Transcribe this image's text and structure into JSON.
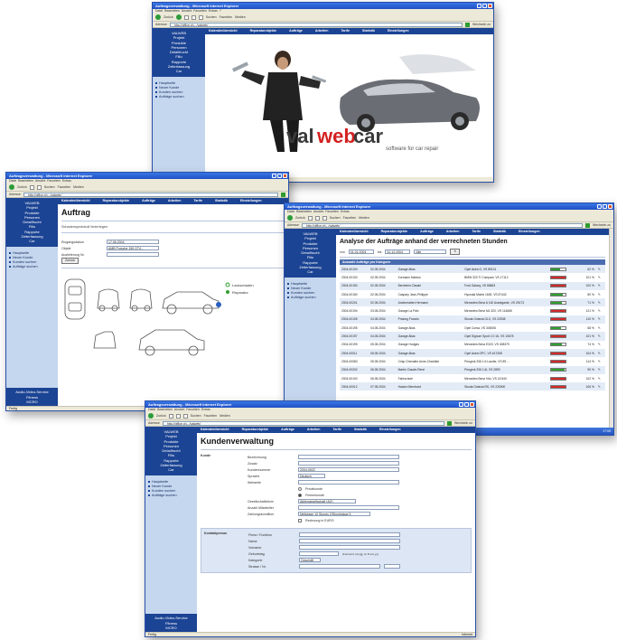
{
  "browser": {
    "title": "Auftragsverwaltung - Microsoft Internet Explorer",
    "menu": [
      "Datei",
      "Bearbeiten",
      "Ansicht",
      "Favoriten",
      "Extras",
      "?"
    ],
    "toolbar": {
      "back": "Zurück",
      "search": "Suchen",
      "favorites": "Favoriten",
      "media": "Medien"
    },
    "address_label": "Adresse",
    "address": "http://office.xh.../valweb/",
    "go_label": "Wechseln zu",
    "status_left": "Fertig",
    "status_right": "Internet"
  },
  "app": {
    "sidebar_nav": [
      "VALWEB",
      "Projekt",
      "Produkte",
      "Personen",
      "Detailfrucht",
      "Filiu",
      "Rapporte",
      "Zeiterfassung",
      "Car"
    ],
    "sidebar_links": [
      "Hauptseite",
      "Neuer Kunde",
      "Kunden suchen",
      "Aufträge suchen"
    ],
    "sidebar_footer": [
      "Audio-Video-Service",
      "Fitness",
      "MCRO"
    ],
    "top_nav": [
      "Kalenderübersicht",
      "Reparaturobjekte",
      "Aufträge",
      "Arbeiten",
      "Tarife",
      "Statistik",
      "Einstellungen"
    ]
  },
  "window1": {
    "logo_val": "val",
    "logo_web": "web",
    "logo_car": "car",
    "logo_tagline": "software for car repair"
  },
  "window2": {
    "page_title": "Auftrag",
    "subtitle": "Schadensprotokoll hinterlegen",
    "fields": [
      {
        "label": "Eingangsdatum",
        "value": "17.06.2004"
      },
      {
        "label": "Objekt",
        "value": "AMB Porsche 150 GT4..."
      },
      {
        "label": "Auslieferung Nr.",
        "value": ""
      }
    ],
    "button": "Zurück",
    "legend": [
      "Lackschaden",
      "Reparatur"
    ]
  },
  "window3": {
    "page_title": "Analyse der Aufträge anhand der verrechneten Stunden",
    "from_label": "von",
    "from": "01.01.2004",
    "to_label": "bis",
    "to": "31.12.2004",
    "filter": "Alle",
    "table_header": "Auswahl Aufträge pro Kategorie",
    "rows": [
      {
        "nr": "2004-00100",
        "date": "02.05.2004",
        "customer": "Garage Alias",
        "vehicle": "Opel Astra G, VS 89131",
        "fill": 0.62,
        "pct": "62 %",
        "color": "#2fa030"
      },
      {
        "nr": "2004-00100",
        "date": "02.05.2004",
        "customer": "Kurmann Markus",
        "vehicle": "BMW 323 TI Compact, VS 17112",
        "fill": 1.0,
        "pct": "101 %",
        "color": "#d22a2a"
      },
      {
        "nr": "2004-00150",
        "date": "02.05.2004",
        "customer": "Bernheim Claude",
        "vehicle": "Ford Galaxy, VS 86863",
        "fill": 1.0,
        "pct": "100 %",
        "color": "#d22a2a"
      },
      {
        "nr": "2004-00150",
        "date": "02.05.2004",
        "customer": "Caspary Jean-Philippe",
        "vehicle": "Hyundai Matrix 1600, VS 87442",
        "fill": 0.8,
        "pct": "80 %",
        "color": "#2fa030"
      },
      {
        "nr": "2004-00201",
        "date": "02.05.2004",
        "customer": "Andermatten Hermann",
        "vehicle": "Mercedes Benz A 140 Avantgarde, VS 25173",
        "fill": 0.71,
        "pct": "71 %",
        "color": "#2fa030"
      },
      {
        "nr": "2004-00194",
        "date": "03.05.2004",
        "customer": "Garage La Paix",
        "vehicle": "Mercedes Benz ML 320, VS 114665",
        "fill": 1.0,
        "pct": "121 %",
        "color": "#d22a2a"
      },
      {
        "nr": "2004-00105",
        "date": "04.05.2004",
        "customer": "Pralong Francis",
        "vehicle": "Skoda Octavia GLX, VS 22538",
        "fill": 1.0,
        "pct": "110 %",
        "color": "#d22a2a"
      },
      {
        "nr": "2004-00195",
        "date": "04.05.2004",
        "customer": "Garage Alias",
        "vehicle": "Opel Corsa, VS 345006",
        "fill": 0.68,
        "pct": "68 %",
        "color": "#2fa030"
      },
      {
        "nr": "2004-00197",
        "date": "04.05.2004",
        "customer": "Garage Alias",
        "vehicle": "Opel Signum Sport 2.0 16, VS 10678",
        "fill": 1.0,
        "pct": "101 %",
        "color": "#d22a2a"
      },
      {
        "nr": "2004-00199",
        "date": "05.05.2004",
        "customer": "Garage Hodges",
        "vehicle": "Mercedes Benz E320, VS 408379",
        "fill": 0.74,
        "pct": "74 %",
        "color": "#2fa030"
      },
      {
        "nr": "2004-00011",
        "date": "05.05.2004",
        "customer": "Garage Alias",
        "vehicle": "Opel Astra OPC, VS 617308",
        "fill": 1.0,
        "pct": "104 %",
        "color": "#d22a2a"
      },
      {
        "nr": "2004-00083",
        "date": "05.05.2004",
        "customer": "Crisp Chevalier Anne-Charlotte",
        "vehicle": "Peugeot 206 1.6 Laurier, VS 89 ...",
        "fill": 1.0,
        "pct": "114 %",
        "color": "#d22a2a"
      },
      {
        "nr": "2004-00202",
        "date": "06.05.2004",
        "customer": "Martin Claude-René",
        "vehicle": "Peugeot 206 1.6i, VS 2890",
        "fill": 0.9,
        "pct": "90 %",
        "color": "#2fa030"
      },
      {
        "nr": "2004-00100",
        "date": "06.05.2004",
        "customer": "Fahrschule",
        "vehicle": "Mercedes Benz Vito, VS 18 540",
        "fill": 1.0,
        "pct": "102 %",
        "color": "#d22a2a"
      },
      {
        "nr": "2004-00012",
        "date": "07.05.2004",
        "customer": "Hadorn Bernhard",
        "vehicle": "Skoda Octavia RS, VS 220900",
        "fill": 1.0,
        "pct": "106 %",
        "color": "#d22a2a"
      }
    ],
    "taskbar": {
      "start": "Start",
      "items": [
        "Microsoft...",
        "Auftragsv..."
      ],
      "clock": "17:05"
    }
  },
  "window4": {
    "page_title": "Kundenverwaltung",
    "section_kunde": "Kunde",
    "fields": [
      {
        "label": "Bezeichnung",
        "value": ""
      },
      {
        "label": "Zusatz",
        "value": ""
      },
      {
        "label": "Kundennummer",
        "value": "2004-0922"
      },
      {
        "label": "Sprache",
        "value": "Deutsch"
      },
      {
        "label": "Webseite",
        "value": ""
      }
    ],
    "radios": [
      "Privatkunde",
      "Firmenkunde"
    ],
    "fields2": [
      {
        "label": "Gesellschaftsform",
        "value": "Aktiengesellschaft (AG)"
      },
      {
        "label": "Anzahl Mitarbeiter",
        "value": ""
      },
      {
        "label": "Zahlungskondition",
        "value": "Nettotage 10 Skonto 2/Skontotage 5"
      }
    ],
    "checkbox": "Rechnung in EURO",
    "section_contact": "Kontaktperson",
    "contact_fields": [
      {
        "label": "Firma / Funktion",
        "value": ""
      },
      {
        "label": "Name",
        "value": ""
      },
      {
        "label": "Vorname",
        "value": ""
      },
      {
        "label": "Geburtstag",
        "value": ""
      },
      {
        "label": "Kategorie",
        "value": "Geschäft"
      },
      {
        "label": "Strasse / Nr.",
        "value": ""
      }
    ],
    "birthday_hint": "(Format tt.mm.jjjj, zu 8.xxx.yy)"
  },
  "colors": {
    "nav_blue": "#1c4494",
    "sidebar": "#c5d7ef",
    "logo_red": "#d42020"
  }
}
